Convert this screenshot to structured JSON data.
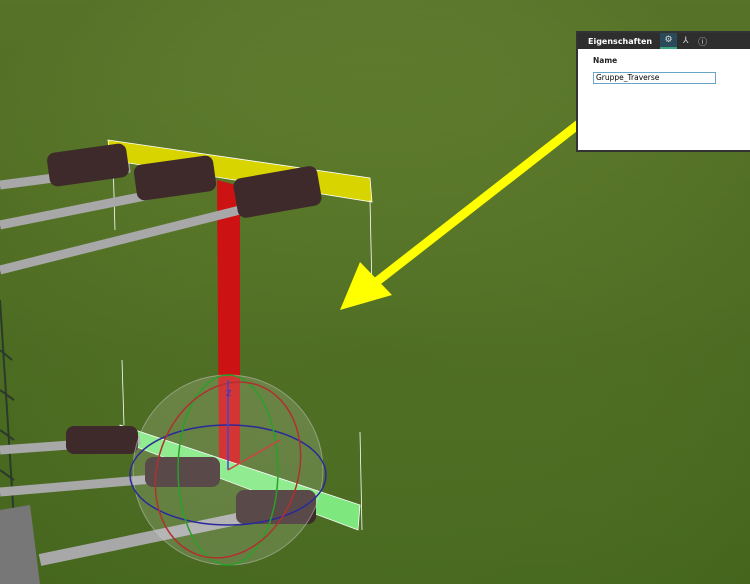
{
  "panel": {
    "title": "Eigenschaften",
    "tabs": [
      {
        "icon": "gear-icon",
        "active": true
      },
      {
        "icon": "hierarchy-icon",
        "active": false
      },
      {
        "icon": "info-icon",
        "active": false
      }
    ],
    "name_label": "Name",
    "name_value": "Gruppe_Traverse"
  },
  "gizmo_axis_label": "Z",
  "colors": {
    "arrow": "#ffff00",
    "selected_upper": "#e0e000",
    "selected_lower": "#66e066",
    "pole": "#d01010"
  }
}
